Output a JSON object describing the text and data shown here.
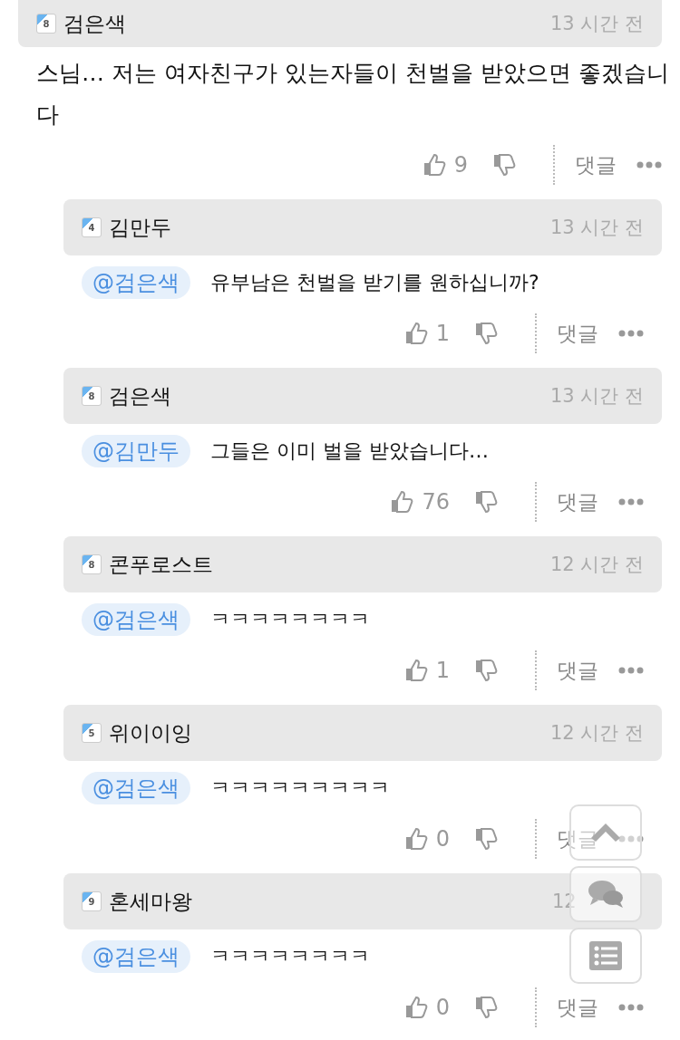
{
  "comment": {
    "level": "8",
    "author": "검은색",
    "time": "13 시간 전",
    "text": "스님… 저는 여자친구가 있는자들이 천벌을 받았으면 좋겠습니다",
    "likes": "9",
    "reply_label": "댓글"
  },
  "replies": [
    {
      "level": "4",
      "author": "김만두",
      "time": "13 시간 전",
      "mention": "@검은색",
      "text": "유부남은 천벌을 받기를 원하십니까?",
      "likes": "1",
      "reply_label": "댓글"
    },
    {
      "level": "8",
      "author": "검은색",
      "time": "13 시간 전",
      "mention": "@김만두",
      "text": "그들은 이미 벌을 받았습니다…",
      "likes": "76",
      "reply_label": "댓글"
    },
    {
      "level": "8",
      "author": "콘푸로스트",
      "time": "12 시간 전",
      "mention": "@검은색",
      "text": "ㅋㅋㅋㅋㅋㅋㅋㅋ",
      "likes": "1",
      "reply_label": "댓글"
    },
    {
      "level": "5",
      "author": "위이이잉",
      "time": "12 시간 전",
      "mention": "@검은색",
      "text": "ㅋㅋㅋㅋㅋㅋㅋㅋㅋ",
      "likes": "0",
      "reply_label": "댓글"
    },
    {
      "level": "9",
      "author": "혼세마왕",
      "time": "12",
      "mention": "@검은색",
      "text": "ㅋㅋㅋㅋㅋㅋㅋㅋ",
      "likes": "0",
      "reply_label": "댓글"
    }
  ]
}
